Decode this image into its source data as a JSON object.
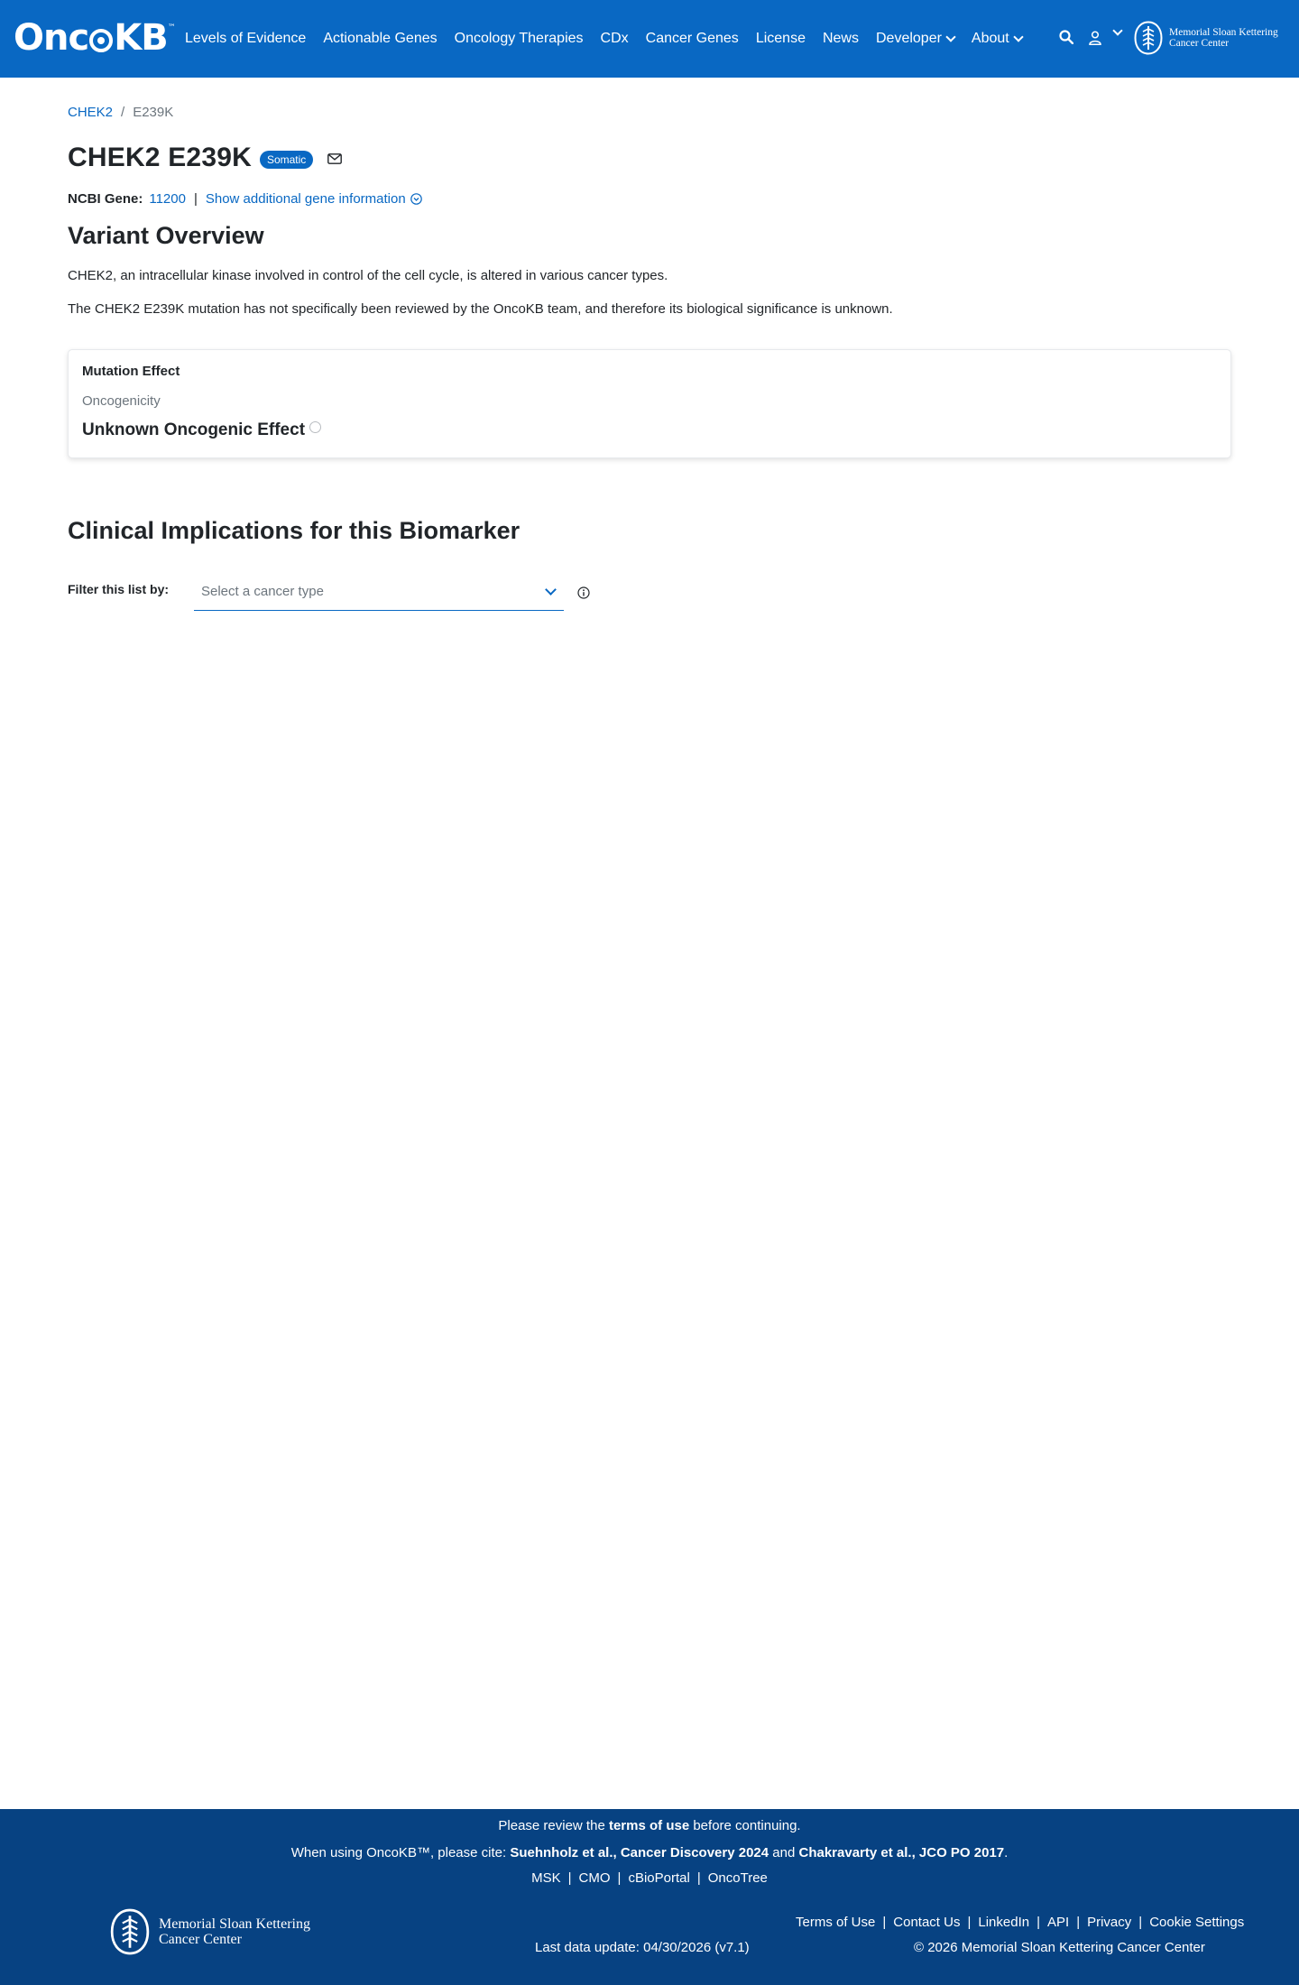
{
  "nav": {
    "logo_text_left": "Onc",
    "logo_text_right": "KB",
    "logo_tm": "™",
    "items": [
      {
        "label": "Levels of Evidence"
      },
      {
        "label": "Actionable Genes"
      },
      {
        "label": "Oncology Therapies"
      },
      {
        "label": "CDx"
      },
      {
        "label": "Cancer Genes"
      },
      {
        "label": "License"
      },
      {
        "label": "News"
      },
      {
        "label": "Developer"
      },
      {
        "label": "About"
      }
    ],
    "msk_line1": "Memorial Sloan Kettering",
    "msk_line2": "Cancer Center"
  },
  "breadcrumb": {
    "gene": "CHEK2",
    "sep": "/",
    "variant": "E239K"
  },
  "header": {
    "title": "CHEK2 E239K",
    "badge": "Somatic"
  },
  "gene_info": {
    "label": "NCBI Gene:",
    "id": "11200",
    "sep": "|",
    "show_more": "Show additional gene information"
  },
  "overview": {
    "heading": "Variant Overview",
    "desc1": "CHEK2, an intracellular kinase involved in control of the cell cycle, is altered in various cancer types.",
    "desc2": "The CHEK2 E239K mutation has not specifically been reviewed by the OncoKB team, and therefore its biological significance is unknown."
  },
  "mutation_effect": {
    "title": "Mutation Effect",
    "sub": "Oncogenicity",
    "value": "Unknown Oncogenic Effect"
  },
  "clinical": {
    "heading": "Clinical Implications for this Biomarker",
    "filter_label": "Filter this list by:",
    "placeholder": "Select a cancer type"
  },
  "footer": {
    "review_prefix": "Please review the ",
    "review_link": "terms of use",
    "review_suffix": " before continuing.",
    "cite_prefix": "When using OncoKB™, please cite: ",
    "cite1": "Suehnholz et al., Cancer Discovery 2024",
    "cite_and": " and ",
    "cite2": "Chakravarty et al., JCO PO 2017",
    "cite_end": ".",
    "links": [
      "MSK",
      "CMO",
      "cBioPortal",
      "OncoTree"
    ],
    "sep": "|",
    "msk_line1": "Memorial Sloan Kettering",
    "msk_line2": "Cancer Center",
    "last_update": "Last data update: 04/30/2026 (v7.1)",
    "right_links": [
      "Terms of Use",
      "Contact Us",
      "LinkedIn",
      "API",
      "Privacy",
      "Cookie Settings"
    ],
    "copyright": "© 2026 Memorial Sloan Kettering Cancer Center"
  },
  "colors": {
    "brand": "#0968c3",
    "footer_bg": "#074282"
  }
}
